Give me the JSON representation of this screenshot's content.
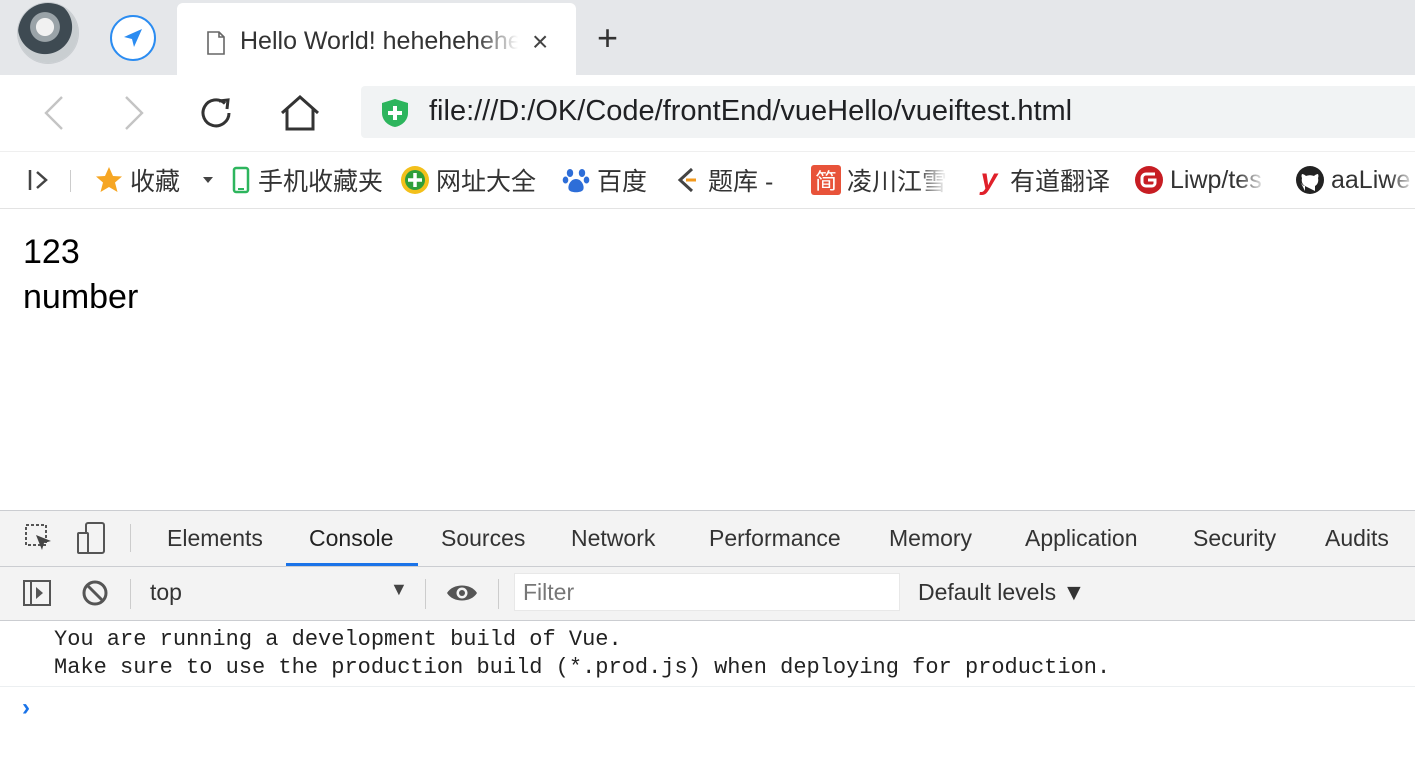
{
  "tab": {
    "title": "Hello World! hehehehehe",
    "close_label": "×",
    "new_tab_label": "+"
  },
  "toolbar": {
    "url": "file:///D:/OK/Code/frontEnd/vueHello/vueiftest.html"
  },
  "bookmarks": {
    "items": [
      {
        "label": "收藏",
        "icon": "star-icon"
      },
      {
        "label": "手机收藏夹",
        "icon": "phone-icon"
      },
      {
        "label": "网址大全",
        "icon": "plus-circle-icon"
      },
      {
        "label": "百度",
        "icon": "baidu-paw-icon"
      },
      {
        "label": "题库 -",
        "icon": "tiku-icon"
      },
      {
        "label": "凌川江雪",
        "icon": "jian-icon"
      },
      {
        "label": "有道翻译",
        "icon": "youdao-icon"
      },
      {
        "label": "Liwp/tes",
        "icon": "gitee-icon"
      },
      {
        "label": "aaLiwe",
        "icon": "github-icon"
      }
    ],
    "jian_glyph": "简",
    "youdao_glyph": "y"
  },
  "page": {
    "line1": "123",
    "line2": "number"
  },
  "devtools": {
    "tabs": [
      "Elements",
      "Console",
      "Sources",
      "Network",
      "Performance",
      "Memory",
      "Application",
      "Security",
      "Audits"
    ],
    "active_tab": "Console",
    "context": "top",
    "filter_placeholder": "Filter",
    "levels_label": "Default levels ▼",
    "console_message": "You are running a development build of Vue.\nMake sure to use the production build (*.prod.js) when deploying for production.",
    "prompt": "›"
  },
  "colors": {
    "accent": "#1a73e8",
    "nav_blue": "#2b8cf1",
    "secure_green": "#2db55d"
  }
}
